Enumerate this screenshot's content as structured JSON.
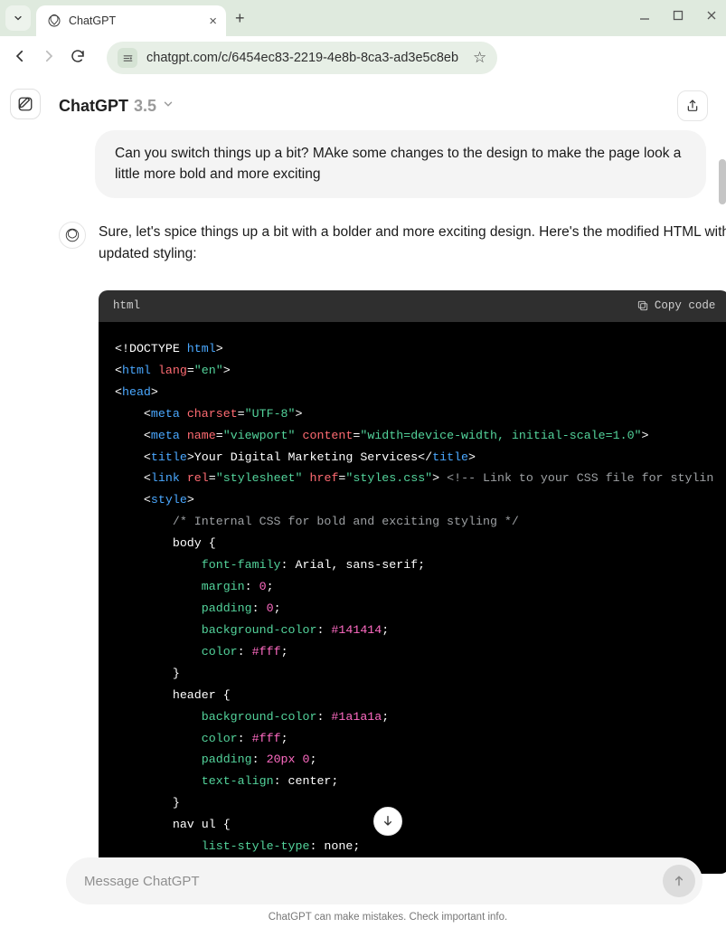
{
  "browser": {
    "tab_title": "ChatGPT",
    "url": "chatgpt.com/c/6454ec83-2219-4e8b-8ca3-ad3e5c8eb"
  },
  "header": {
    "title": "ChatGPT",
    "version": "3.5"
  },
  "conversation": {
    "user_message": "Can you switch things up a bit? MAke some changes to the design to make the page look a little more bold and more exciting",
    "assistant_intro": "Sure, let's spice things up a bit with a bolder and more exciting design. Here's the modified HTML with updated styling:"
  },
  "code": {
    "lang_label": "html",
    "copy_label": "Copy code",
    "source": {
      "doctype": "<!DOCTYPE html>",
      "html_tag": "html",
      "lang_attr": "lang",
      "lang_val": "\"en\"",
      "head_tag": "head",
      "meta_tag": "meta",
      "charset_attr": "charset",
      "charset_val": "\"UTF-8\"",
      "name_attr": "name",
      "viewport_val": "\"viewport\"",
      "content_attr": "content",
      "content_val": "\"width=device-width, initial-scale=1.0\"",
      "title_tag": "title",
      "title_text": "Your Digital Marketing Services",
      "link_tag": "link",
      "rel_attr": "rel",
      "rel_val": "\"stylesheet\"",
      "href_attr": "href",
      "href_val": "\"styles.css\"",
      "link_comment": "<!-- Link to your CSS file for stylin",
      "style_tag": "style",
      "css_comment": "/* Internal CSS for bold and exciting styling */",
      "body_sel": "body {",
      "font_family_prop": "font-family",
      "font_family_val": ": Arial, sans-serif;",
      "margin_prop": "margin",
      "zero_val": "0",
      "padding_prop": "padding",
      "bgcolor_prop": "background-color",
      "bg1_val": "#141414",
      "color_prop": "color",
      "fff_val": "#fff",
      "close_brace": "}",
      "header_sel": "header {",
      "bg2_val": "#1a1a1a",
      "pad2_val": "20px",
      "textalign_prop": "text-align",
      "center_val": ": center;",
      "navul_sel": "nav ul {",
      "liststyle_prop": "list-style-type",
      "none_val": ": none;"
    }
  },
  "composer": {
    "placeholder": "Message ChatGPT"
  },
  "footer": "ChatGPT can make mistakes. Check important info."
}
